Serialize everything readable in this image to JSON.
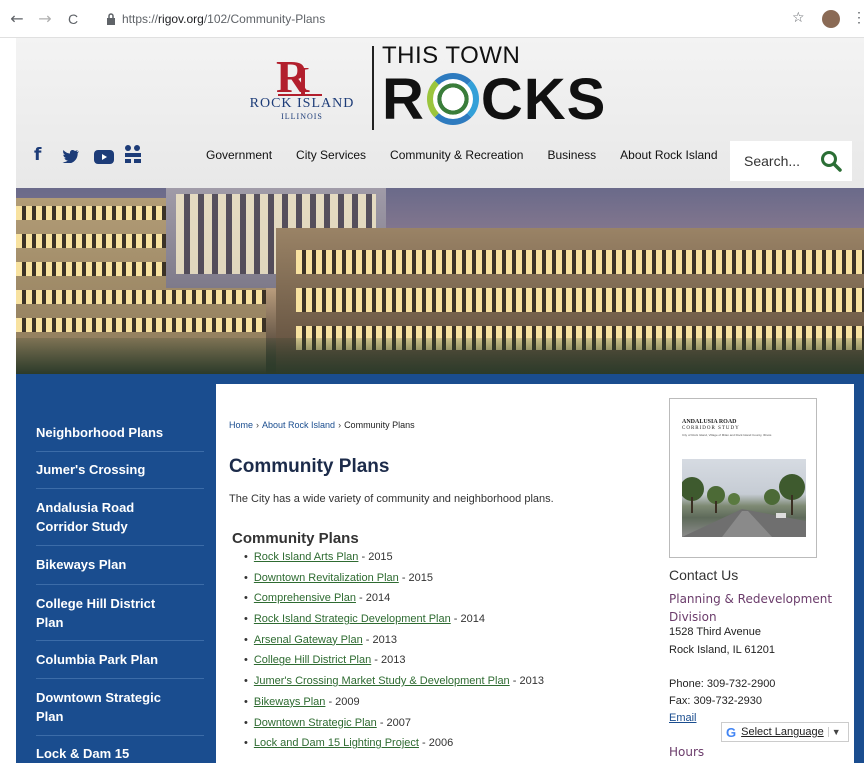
{
  "browser": {
    "back": "←",
    "forward": "→",
    "reload": "C",
    "url_prefix": "https://",
    "url_domain": "rigov.org",
    "url_path": "/102/Community-Plans",
    "star": "☆",
    "menu": "⋮"
  },
  "header": {
    "logo_text": "ROCK ISLAND",
    "logo_sub": "ILLINOIS",
    "tagline_top": "THIS TOWN",
    "tagline_r": "R",
    "tagline_rest": "CKS",
    "social": [
      {
        "glyph": "f",
        "name": "facebook-icon"
      },
      {
        "glyph": "🐦",
        "name": "twitter-icon"
      },
      {
        "glyph": "▶",
        "name": "youtube-icon"
      },
      {
        "glyph": "⁂",
        "name": "nextdoor-icon"
      }
    ],
    "nav": [
      "Government",
      "City Services",
      "Community & Recreation",
      "Business",
      "About Rock Island"
    ],
    "search_placeholder": "Search..."
  },
  "sidebar": {
    "items": [
      "Neighborhood Plans",
      "Jumer's Crossing",
      "Andalusia Road Corridor Study",
      "Bikeways Plan",
      "College Hill District Plan",
      "Columbia Park Plan",
      "Downtown Strategic Plan",
      "Lock & Dam 15"
    ]
  },
  "main": {
    "breadcrumb": [
      "Home",
      "About Rock Island",
      "Community Plans"
    ],
    "breadcrumb_sep": "›",
    "title": "Community Plans",
    "intro": "The City has a wide variety of community and neighborhood plans.",
    "section_heading": "Community Plans",
    "plans": [
      {
        "link": "Rock Island Arts Plan",
        "year": " - 2015"
      },
      {
        "link": "Downtown Revitalization Plan",
        "year": " - 2015"
      },
      {
        "link": "Comprehensive Plan",
        "year": " - 2014"
      },
      {
        "link": "Rock Island Strategic Development Plan",
        "year": " - 2014"
      },
      {
        "link": "Arsenal Gateway Plan",
        "year": " - 2013"
      },
      {
        "link": "College Hill District Plan",
        "year": " - 2013"
      },
      {
        "link": "Jumer's Crossing Market Study & Development Plan",
        "year": " - 2013"
      },
      {
        "link": "Bikeways Plan",
        "year": " - 2009"
      },
      {
        "link": "Downtown Strategic Plan",
        "year": " - 2007"
      },
      {
        "link": "Lock and Dam 15 Lighting Project",
        "year": " - 2006"
      }
    ]
  },
  "right": {
    "doc_title": "ANDALUSIA ROAD",
    "doc_subtitle": "CORRIDOR STUDY",
    "doc_caption": "City of Rock Island, Village of Milan and Rock Island County, Illinois",
    "contact_heading": "Contact Us",
    "dept": "Planning & Redevelopment Division",
    "address1": "1528 Third Avenue",
    "address2": "Rock Island, IL 61201",
    "phone": "Phone: 309-732-2900",
    "fax": "Fax: 309-732-2930",
    "email": "Email",
    "hours": "Hours",
    "translate_g": "G",
    "translate_label": "Select Language",
    "translate_arrow": "▼"
  }
}
